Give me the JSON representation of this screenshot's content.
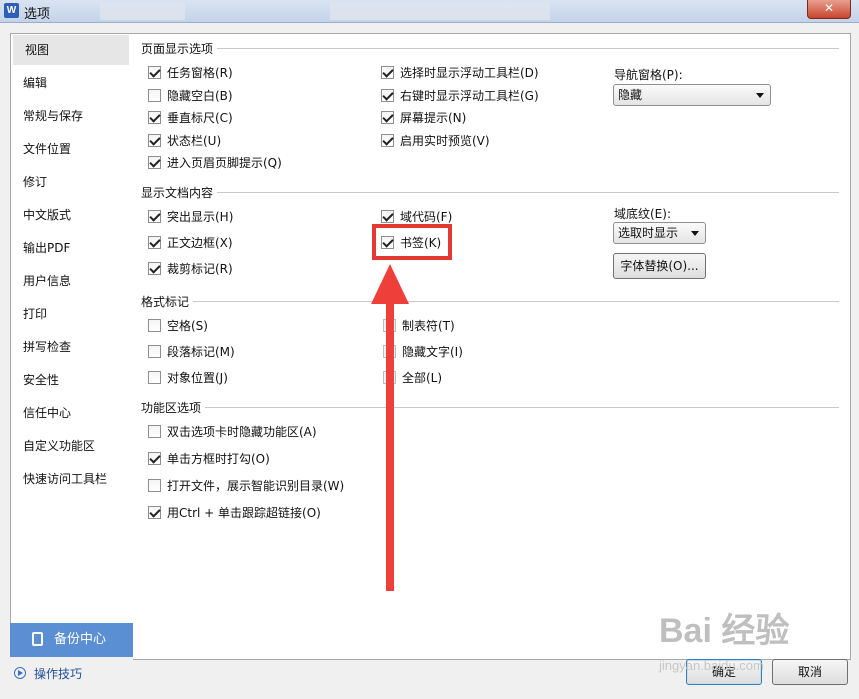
{
  "window": {
    "icon": "W",
    "title": "选项",
    "close": "✕"
  },
  "sidebar": {
    "items": [
      {
        "label": "视图"
      },
      {
        "label": "编辑"
      },
      {
        "label": "常规与保存"
      },
      {
        "label": "文件位置"
      },
      {
        "label": "修订"
      },
      {
        "label": "中文版式"
      },
      {
        "label": "输出PDF"
      },
      {
        "label": "用户信息"
      },
      {
        "label": "打印"
      },
      {
        "label": "拼写检查"
      },
      {
        "label": "安全性"
      },
      {
        "label": "信任中心"
      },
      {
        "label": "自定义功能区"
      },
      {
        "label": "快速访问工具栏"
      }
    ],
    "backup_label": "备份中心",
    "tips_label": "操作技巧"
  },
  "sections": {
    "page_display": "页面显示选项",
    "doc_content": "显示文档内容",
    "format_marks": "格式标记",
    "ribbon": "功能区选项"
  },
  "page_display": {
    "task_pane": {
      "label": "任务窗格(R)",
      "checked": true
    },
    "hide_space": {
      "label": "隐藏空白(B)",
      "checked": false
    },
    "vertical_ruler": {
      "label": "垂直标尺(C)",
      "checked": true
    },
    "status_bar": {
      "label": "状态栏(U)",
      "checked": true
    },
    "header_footer_tip": {
      "label": "进入页眉页脚提示(Q)",
      "checked": true
    },
    "float_toolbar_select": {
      "label": "选择时显示浮动工具栏(D)",
      "checked": true
    },
    "float_toolbar_right": {
      "label": "右键时显示浮动工具栏(G)",
      "checked": true
    },
    "screen_tip": {
      "label": "屏幕提示(N)",
      "checked": true
    },
    "live_preview": {
      "label": "启用实时预览(V)",
      "checked": true
    },
    "nav_pane_label": "导航窗格(P):",
    "nav_pane_value": "隐藏"
  },
  "doc_content": {
    "highlight": {
      "label": "突出显示(H)",
      "checked": true
    },
    "text_border": {
      "label": "正文边框(X)",
      "checked": true
    },
    "crop_marks": {
      "label": "裁剪标记(R)",
      "checked": true
    },
    "field_codes": {
      "label": "域代码(F)",
      "checked": true
    },
    "bookmarks": {
      "label": "书签(K)",
      "checked": true
    },
    "field_shading_label": "域底纹(E):",
    "field_shading_value": "选取时显示",
    "font_sub_button": "字体替换(O)..."
  },
  "format_marks": {
    "space": {
      "label": "空格(S)",
      "checked": false
    },
    "paragraph": {
      "label": "段落标记(M)",
      "checked": false
    },
    "object_pos": {
      "label": "对象位置(J)",
      "checked": false
    },
    "tab": {
      "label": "制表符(T)",
      "checked": false
    },
    "hidden_text": {
      "label": "隐藏文字(I)",
      "checked": false
    },
    "all": {
      "label": "全部(L)",
      "checked": false
    }
  },
  "ribbon": {
    "dblclick_hide": {
      "label": "双击选项卡时隐藏功能区(A)",
      "checked": false
    },
    "single_click_check": {
      "label": "单击方框时打勾(O)",
      "checked": true
    },
    "smart_toc": {
      "label": "打开文件，展示智能识别目录(W)",
      "checked": false
    },
    "ctrl_click_link": {
      "label": "用Ctrl + 单击跟踪超链接(O)",
      "checked": true
    }
  },
  "buttons": {
    "ok": "确定",
    "cancel": "取消"
  },
  "watermark": {
    "main": "Bai 经验",
    "sub": "jingyan.baidu.com"
  },
  "colors": {
    "annotation": "#e23b35",
    "backup_bg": "#5b8fd3",
    "accent": "#3b6fc4"
  }
}
